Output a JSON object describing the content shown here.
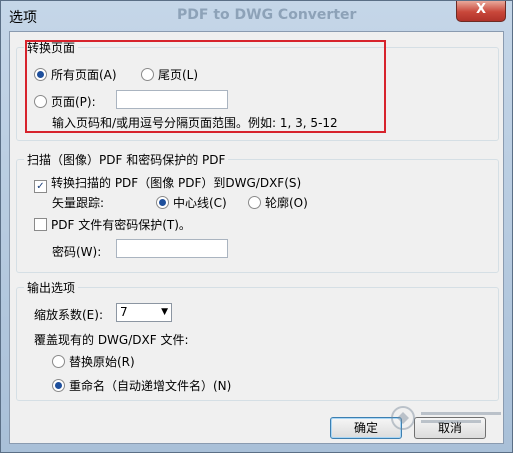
{
  "window": {
    "title": "选项",
    "ghost_title": "PDF to DWG Converter",
    "close_glyph": "X"
  },
  "convert_pages": {
    "title": "转换页面",
    "all_pages": "所有页面(A)",
    "last_page": "尾页(L)",
    "pages": "页面(P):",
    "pages_value": "",
    "hint": "输入页码和/或用逗号分隔页面范围。例如: 1, 3, 5-12",
    "selected": "all_pages"
  },
  "scan_pdf": {
    "title": "扫描（图像）PDF 和密码保护的 PDF",
    "convert_scanned": "转换扫描的 PDF（图像 PDF）到DWG/DXF(S)",
    "convert_scanned_checked": true,
    "vector_trace_label": "矢量跟踪:",
    "centerline": "中心线(C)",
    "outline": "轮廓(O)",
    "trace_selected": "centerline",
    "password_protected": "PDF 文件有密码保护(T)。",
    "password_protected_checked": false,
    "password_label": "密码(W):",
    "password_value": ""
  },
  "output": {
    "title": "输出选项",
    "scale_label": "缩放系数(E):",
    "scale_value": "7",
    "overwrite_label": "覆盖现有的 DWG/DXF 文件:",
    "replace_original": "替换原始(R)",
    "rename": "重命名（自动递增文件名）(N)",
    "overwrite_selected": "rename"
  },
  "buttons": {
    "ok": "确定",
    "cancel": "取消"
  },
  "colors": {
    "highlight": "#d7232c",
    "accent": "#1e4f9c"
  }
}
